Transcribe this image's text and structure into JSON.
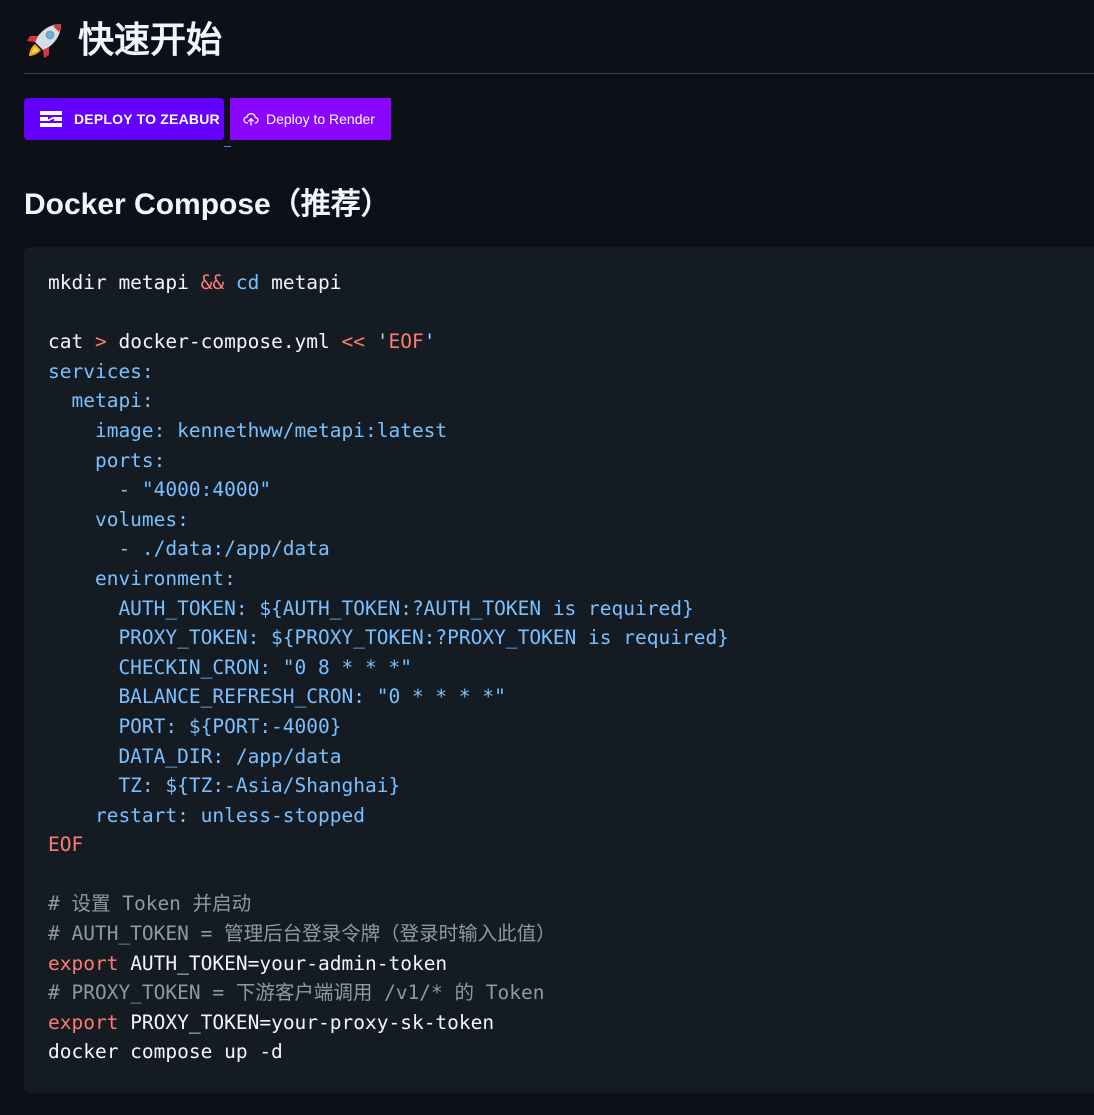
{
  "heading": {
    "icon": "rocket-icon",
    "title": "快速开始"
  },
  "buttons": {
    "zeabur": {
      "icon": "zeabur-logo-icon",
      "label": "DEPLOY TO ZEABUR"
    },
    "render": {
      "icon": "cloud-upload-icon",
      "label": "Deploy to Render"
    }
  },
  "subheading": "Docker Compose（推荐）",
  "code": {
    "l1": {
      "a": "mkdir metapi ",
      "op": "&&",
      "b": " ",
      "cd": "cd",
      "c": " metapi"
    },
    "l3": {
      "a": "cat ",
      "gt": ">",
      "b": " docker-compose.yml ",
      "heredoc": "<<",
      "c": " ",
      "q1": "'",
      "eof": "EOF",
      "q2": "'"
    },
    "y": [
      "services:",
      "  metapi:",
      "    image: kennethww/metapi:latest",
      "    ports:",
      "      - \"4000:4000\"",
      "    volumes:",
      "      - ./data:/app/data",
      "    environment:",
      "      AUTH_TOKEN: ${AUTH_TOKEN:?AUTH_TOKEN is required}",
      "      PROXY_TOKEN: ${PROXY_TOKEN:?PROXY_TOKEN is required}",
      "      CHECKIN_CRON: \"0 8 * * *\"",
      "      BALANCE_REFRESH_CRON: \"0 * * * *\"",
      "      PORT: ${PORT:-4000}",
      "      DATA_DIR: /app/data",
      "      TZ: ${TZ:-Asia/Shanghai}",
      "    restart: unless-stopped"
    ],
    "eof": "EOF",
    "c1": "# 设置 Token 并启动",
    "c2": "# AUTH_TOKEN = 管理后台登录令牌（登录时输入此值）",
    "e1": {
      "kw": "export",
      "rest": " AUTH_TOKEN=your-admin-token"
    },
    "c3": "# PROXY_TOKEN = 下游客户端调用 /v1/* 的 Token",
    "e2": {
      "kw": "export",
      "rest": " PROXY_TOKEN=your-proxy-sk-token"
    },
    "last": "docker compose up -d"
  },
  "colors": {
    "zeabur_button": "#6300ff",
    "render_button": "#8a05ff",
    "code_background": "#151b23"
  }
}
